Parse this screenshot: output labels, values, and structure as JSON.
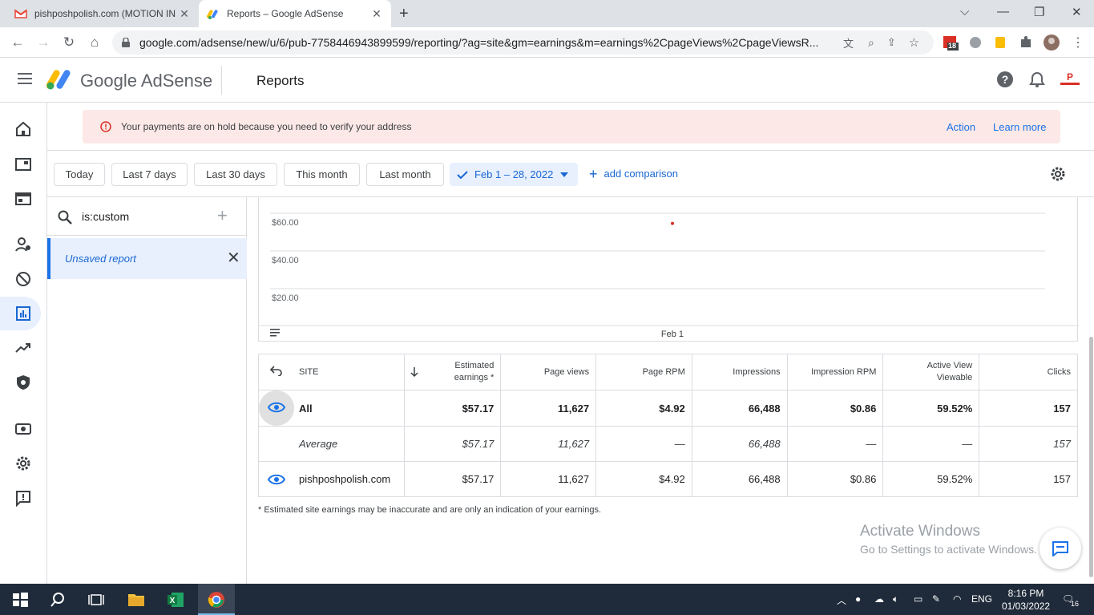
{
  "browser": {
    "tabs": [
      {
        "title": "pishposhpolish.com (MOTION IN",
        "icon": "gmail-icon"
      },
      {
        "title": "Reports – Google AdSense",
        "icon": "adsense-icon"
      }
    ],
    "url": "google.com/adsense/new/u/6/pub-7758446943899599/reporting/?ag=site&gm=earnings&m=earnings%2CpageViews%2CpageViewsR...",
    "ext_badge": "18"
  },
  "app": {
    "brand": "Google AdSense",
    "title": "Reports"
  },
  "alert": {
    "message": "Your payments are on hold because you need to verify your address",
    "action": "Action",
    "learn_more": "Learn more"
  },
  "filters": {
    "today": "Today",
    "last7": "Last 7 days",
    "last30": "Last 30 days",
    "this_month": "This month",
    "last_month": "Last month",
    "range": "Feb 1 – 28, 2022",
    "add_comparison": "add comparison"
  },
  "side": {
    "search_query": "is:custom",
    "report_name": "Unsaved report"
  },
  "chart_data": {
    "type": "line",
    "y_tick_labels": [
      "$60.00",
      "$40.00",
      "$20.00"
    ],
    "x_tick_labels": [
      "Feb 1"
    ],
    "points": [
      {
        "x": "Feb 1",
        "y": 57.17
      }
    ],
    "grid": true,
    "point_color": "#d93025"
  },
  "table": {
    "headers": {
      "site": "SITE",
      "est_earnings": "Estimated earnings *",
      "page_views": "Page views",
      "page_rpm": "Page RPM",
      "impressions": "Impressions",
      "impression_rpm": "Impression RPM",
      "active_view": "Active View Viewable",
      "clicks": "Clicks"
    },
    "rows": [
      {
        "label": "All",
        "est_earnings": "$57.17",
        "page_views": "11,627",
        "page_rpm": "$4.92",
        "impressions": "66,488",
        "impression_rpm": "$0.86",
        "active_view": "59.52%",
        "clicks": "157"
      },
      {
        "label": "Average",
        "est_earnings": "$57.17",
        "page_views": "11,627",
        "page_rpm": "—",
        "impressions": "66,488",
        "impression_rpm": "—",
        "active_view": "—",
        "clicks": "157"
      },
      {
        "label": "pishposhpolish.com",
        "est_earnings": "$57.17",
        "page_views": "11,627",
        "page_rpm": "$4.92",
        "impressions": "66,488",
        "impression_rpm": "$0.86",
        "active_view": "59.52%",
        "clicks": "157"
      }
    ],
    "footnote": "* Estimated site earnings may be inaccurate and are only an indication of your earnings."
  },
  "watermark": {
    "line1": "Activate Windows",
    "line2": "Go to Settings to activate Windows."
  },
  "taskbar": {
    "lang": "ENG",
    "time": "8:16 PM",
    "date": "01/03/2022",
    "notif_count": "16"
  },
  "colors": {
    "accent": "#1a73e8",
    "alert_bg": "#fce8e6",
    "selected_bg": "#e8f0fe"
  }
}
